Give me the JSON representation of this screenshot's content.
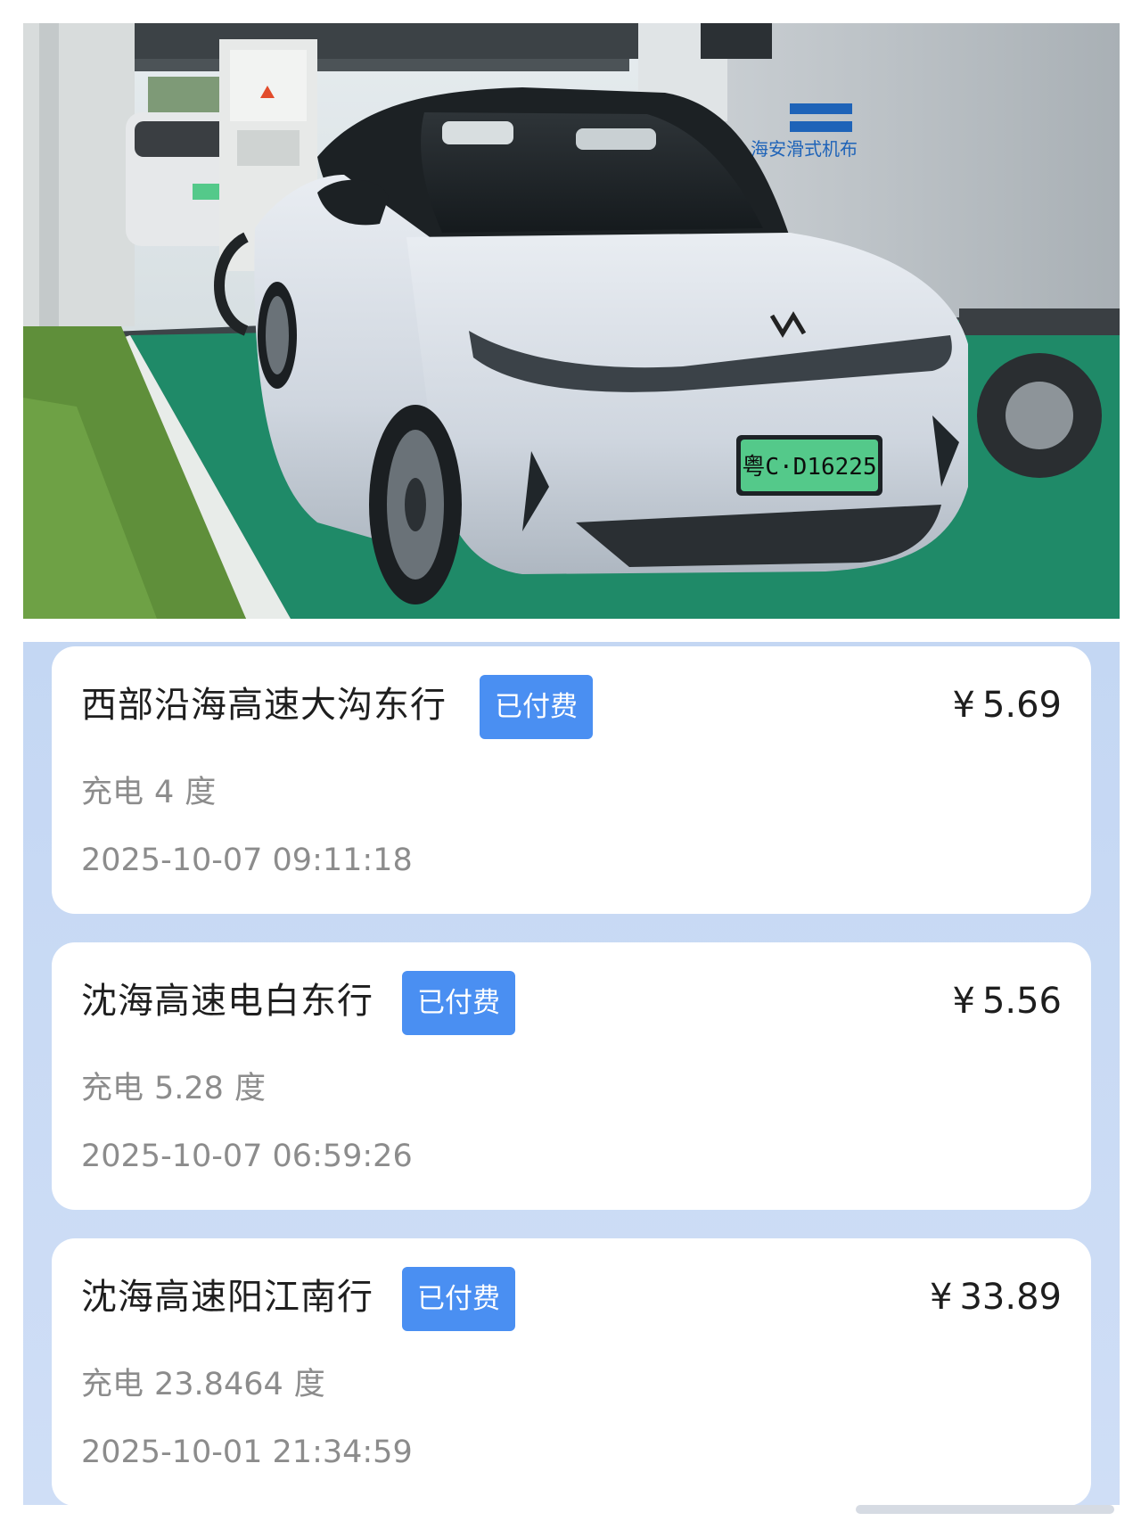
{
  "photo": {
    "plate_text": "粤C·D16225",
    "truck_sign_text": "海安滑式机布"
  },
  "orders": [
    {
      "station": "西部沿海高速大沟东行",
      "status": "已付费",
      "currency": "¥",
      "amount": "5.69",
      "energy_label": "充电",
      "energy_value": "4",
      "energy_unit": "度",
      "time": "2025-10-07 09:11:18"
    },
    {
      "station": "沈海高速电白东行",
      "status": "已付费",
      "currency": "¥",
      "amount": "5.56",
      "energy_label": "充电",
      "energy_value": "5.28",
      "energy_unit": "度",
      "time": "2025-10-07 06:59:26"
    },
    {
      "station": "沈海高速阳江南行",
      "status": "已付费",
      "currency": "¥",
      "amount": "33.89",
      "energy_label": "充电",
      "energy_value": "23.8464",
      "energy_unit": "度",
      "time": "2025-10-01 21:34:59"
    }
  ],
  "colors": {
    "badge": "#4a8ff2",
    "panel_bg": "#c8d9f4",
    "secondary_text": "#8c8c8c",
    "plate_green": "#54c98a"
  }
}
